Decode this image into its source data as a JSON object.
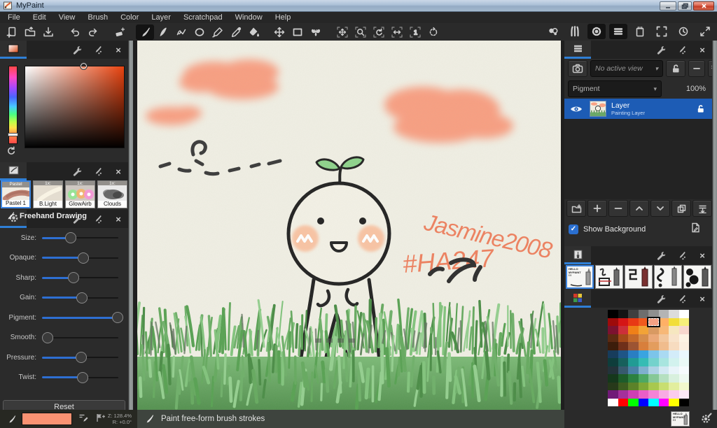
{
  "window": {
    "title": "MyPaint"
  },
  "icons": {
    "close": "×",
    "caret": "▾",
    "check": "✓",
    "one": "1"
  },
  "menu": {
    "items": [
      "File",
      "Edit",
      "View",
      "Brush",
      "Color",
      "Layer",
      "Scratchpad",
      "Window",
      "Help"
    ]
  },
  "toolbar": {
    "left_icons": [
      "new-file",
      "open-file",
      "save-file",
      "undo",
      "redo",
      "eraser",
      "freehand-brush",
      "ink-tool",
      "connected-lines",
      "ellipse-tool",
      "curve-tool",
      "color-picker-tool",
      "flood-fill",
      "move-layer",
      "frame-edit",
      "symmetry-butterfly",
      "pan-view",
      "zoom-view",
      "rotate-view",
      "mirror-view",
      "zoom-1to1",
      "reset-view"
    ],
    "right_icons": [
      "symmetry-toggle",
      "brush-list",
      "brush-settings",
      "brush-menu",
      "scratchpad",
      "fullscreen",
      "history",
      "expand-panels"
    ],
    "active_tool": "freehand-brush"
  },
  "left_panel": {
    "brush_presets": {
      "presets": [
        {
          "group": "Pastel",
          "name": "Pastel 1",
          "selected": true
        },
        {
          "group": "1x:",
          "name": "B.Light"
        },
        {
          "group": "1x:",
          "name": "GlowAirb"
        },
        {
          "group": "1x:",
          "name": "Clouds"
        }
      ]
    },
    "tool_options": {
      "title": "Freehand Drawing",
      "sliders": [
        {
          "label": "Size:",
          "pct": 38
        },
        {
          "label": "Opaque:",
          "pct": 54
        },
        {
          "label": "Sharp:",
          "pct": 41
        },
        {
          "label": "Gain:",
          "pct": 52
        },
        {
          "label": "Pigment:",
          "pct": 99
        },
        {
          "label": "Smooth:",
          "pct": 7
        },
        {
          "label": "Pressure:",
          "pct": 51
        },
        {
          "label": "Twist:",
          "pct": 53
        }
      ],
      "reset_label": "Reset"
    }
  },
  "canvas": {
    "signature": "Jasmine2008",
    "hashtag": "#HA247"
  },
  "right_panel": {
    "layers": {
      "view_dropdown": "No active view",
      "mode_dropdown": "Pigment",
      "opacity": "100%",
      "layer": {
        "name": "Layer",
        "type": "Painting Layer"
      },
      "show_background_label": "Show Background"
    },
    "recent_brushes": {
      "first_thumb_text": [
        "HELLO",
        "MYPAINT",
        "!!!"
      ]
    },
    "palette": {
      "selected": {
        "row": 1,
        "col": 4
      },
      "rows": [
        [
          "#000000",
          "#141414",
          "#3f3f3f",
          "#6e6e6e",
          "#8f8f8f",
          "#b4b4b4",
          "#dcdcdc",
          "#ffffff"
        ],
        [
          "#9e0b0b",
          "#d51616",
          "#e83914",
          "#f05a1e",
          "#f5a184",
          "#ffb066",
          "#f2de3a",
          "#f7ef7a"
        ],
        [
          "#7c1230",
          "#cc2f3a",
          "#ef8018",
          "#f2a337",
          "#d99a62",
          "#f7b877",
          "#f6e7c0",
          "#f8d7ce"
        ],
        [
          "#5c2a12",
          "#a34819",
          "#c3692b",
          "#d58c4b",
          "#eaa878",
          "#f2c69c",
          "#f8e3cb",
          "#fdf3e4"
        ],
        [
          "#3c1d0b",
          "#6f2f1a",
          "#9c5433",
          "#d87f3c",
          "#e39d5e",
          "#f0bc8d",
          "#f7dcc0",
          "#fcefe0"
        ],
        [
          "#173c5c",
          "#1f5586",
          "#2a7ec2",
          "#3aa4e0",
          "#7cc4ea",
          "#aadaf2",
          "#d3ecf9",
          "#eaf7fd"
        ],
        [
          "#0e3d3b",
          "#17605c",
          "#219b94",
          "#36bcb4",
          "#74d2cc",
          "#a8e5df",
          "#d2f2ee",
          "#eaf9f6"
        ],
        [
          "#23333a",
          "#375a6e",
          "#4a82a6",
          "#7fb0cd",
          "#aed2e4",
          "#d2e8f2",
          "#e9f4f9",
          "#f6fbfd"
        ],
        [
          "#15381c",
          "#1d5c2a",
          "#2c8140",
          "#4da863",
          "#86c897",
          "#b5e0c0",
          "#d8f0de",
          "#eef9f1"
        ],
        [
          "#27391a",
          "#3d5c20",
          "#5c8229",
          "#7fa837",
          "#a8c84e",
          "#c8de71",
          "#e2ee9e",
          "#f2f8cd"
        ],
        [
          "#711a78",
          "#a4309c",
          "#cf3fb4",
          "#ea5ec7",
          "#f383d6",
          "#f8abe3",
          "#fbccee",
          "#fde8f7"
        ],
        [
          "#ffffff",
          "#ff0000",
          "#00ff00",
          "#0000ff",
          "#00ffff",
          "#ff00ff",
          "#ffff00",
          "#000000"
        ]
      ]
    }
  },
  "status_bar": {
    "zoom": "Z: 128.4%",
    "rotation": "R: +0.0°",
    "message": "Paint free-form brush strokes",
    "color_swatch": "#fa9272",
    "thumb_text": [
      "HELLO",
      "MYPAINT",
      "!!!"
    ]
  },
  "colors": {
    "accent_blue": "#2f7fd6",
    "selection_blue": "#1d5cb5",
    "cloud_salmon": "#f9997a",
    "canvas_paper": "#f0efe4",
    "handwriting_salmon": "#ee8160"
  }
}
